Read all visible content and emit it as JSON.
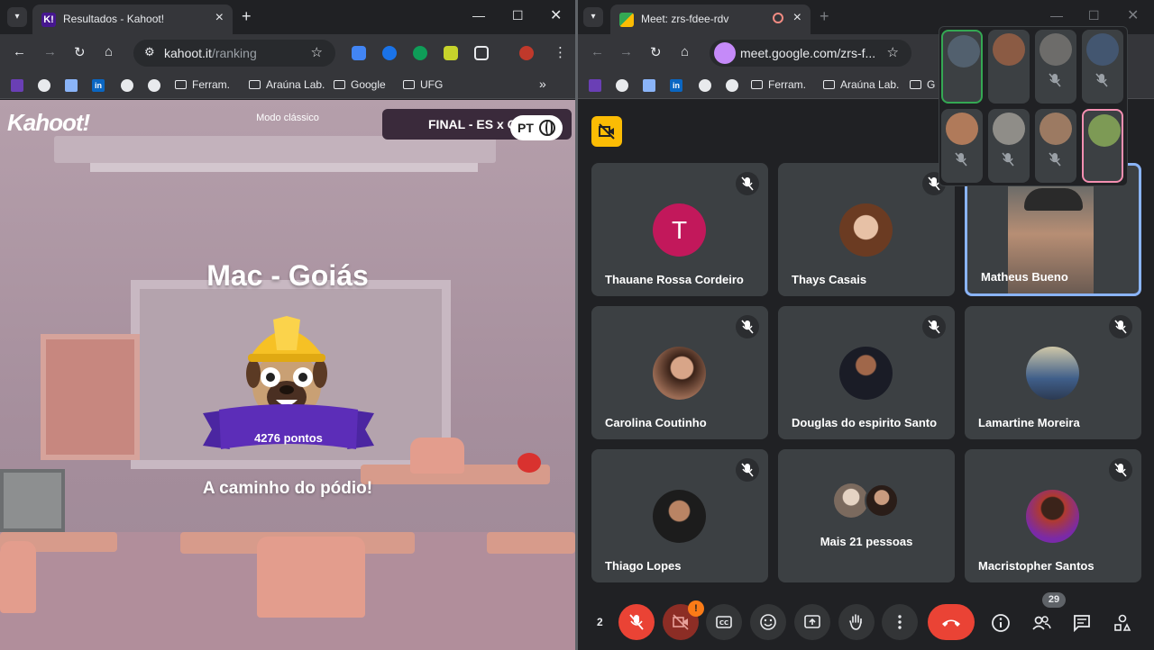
{
  "left_window": {
    "tab_title": "Resultados - Kahoot!",
    "url_host": "kahoot.it",
    "url_path": "/ranking",
    "bookmarks": [
      "Ferram.",
      "Araúna Lab.",
      "Google",
      "UFG"
    ],
    "kahoot": {
      "logo": "Kahoot!",
      "mode": "Modo clássico",
      "game_title": "FINAL - ES x CE",
      "language": "PT",
      "player_name": "Mac - Goiás",
      "points": "4276 pontos",
      "status": "A caminho do pódio!"
    }
  },
  "right_window": {
    "tab_title": "Meet: zrs-fdee-rdv",
    "url": "meet.google.com/zrs-f...",
    "bookmarks": [
      "Ferram.",
      "Araúna Lab.",
      "G"
    ],
    "tiles": [
      {
        "name": "Thauane Rossa Cordeiro",
        "initial": "T",
        "muted": true
      },
      {
        "name": "Thays Casais",
        "muted": true
      },
      {
        "name": "Matheus Bueno",
        "muted": false
      },
      {
        "name": "Carolina Coutinho",
        "muted": true
      },
      {
        "name": "Douglas do espirito Santo",
        "muted": true
      },
      {
        "name": "Lamartine Moreira",
        "muted": true
      },
      {
        "name": "Thiago Lopes",
        "muted": true
      },
      {
        "name": "Mais 21 pessoas",
        "muted": false
      },
      {
        "name": "Macristopher Santos",
        "muted": true
      }
    ],
    "controls": {
      "raised_count": "2",
      "camera_alert": "!",
      "participant_count": "29"
    },
    "colors": {
      "accent_red": "#ea4335",
      "tile_bg": "#3c4043",
      "avatar_pink": "#c2185b",
      "speaking_border": "#8ab4f8"
    }
  }
}
